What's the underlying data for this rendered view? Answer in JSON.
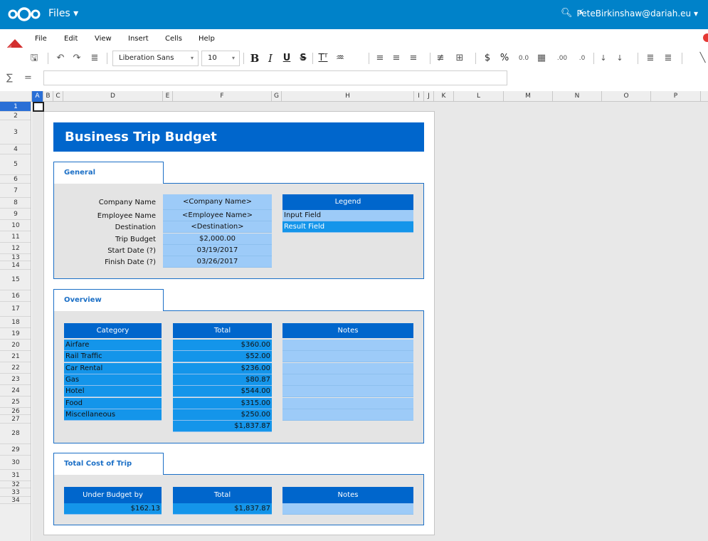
{
  "app": {
    "title": "Files ▾",
    "user": "PeteBirkinshaw@dariah.eu ▾",
    "brand_color": "#0082c9"
  },
  "menu": [
    "File",
    "Edit",
    "View",
    "Insert",
    "Cells",
    "Help"
  ],
  "toolbar": {
    "font_name": "Liberation Sans",
    "font_size": "10",
    "bold": "B",
    "italic": "I",
    "underline": "U",
    "strike": "S",
    "currency": "$",
    "percent": "%",
    "decimal": "0.0",
    "add_decimal": ".00",
    "remove_decimal": ".0"
  },
  "formula_bar": {
    "sum": "∑",
    "equals": "=",
    "value": ""
  },
  "columns": [
    "A",
    "B",
    "C",
    "D",
    "E",
    "F",
    "G",
    "H",
    "I",
    "J",
    "K",
    "L",
    "M",
    "N",
    "O",
    "P"
  ],
  "rows": [
    "1",
    "2",
    "3",
    "4",
    "5",
    "6",
    "7",
    "8",
    "9",
    "10",
    "11",
    "12",
    "13",
    "14",
    "15",
    "16",
    "17",
    "18",
    "19",
    "20",
    "21",
    "22",
    "23",
    "24",
    "25",
    "26",
    "27",
    "28",
    "29",
    "30",
    "31",
    "32",
    "33",
    "34"
  ],
  "sheet": {
    "title": "Business Trip Budget",
    "general": {
      "tab": "General",
      "fields": [
        {
          "label": "Company Name",
          "value": "<Company Name>"
        },
        {
          "label": "Employee Name",
          "value": "<Employee Name>"
        },
        {
          "label": "Destination",
          "value": "<Destination>"
        },
        {
          "label": "Trip Budget",
          "value": "$2,000.00"
        },
        {
          "label": "Start Date (?)",
          "value": "03/19/2017"
        },
        {
          "label": "Finish Date (?)",
          "value": "03/26/2017"
        }
      ],
      "legend": {
        "title": "Legend",
        "input": "Input Field",
        "result": "Result Field"
      }
    },
    "overview": {
      "tab": "Overview",
      "headers": {
        "category": "Category",
        "total": "Total",
        "notes": "Notes"
      },
      "rows": [
        {
          "category": "Airfare",
          "total": "$360.00"
        },
        {
          "category": "Rail Traffic",
          "total": "$52.00"
        },
        {
          "category": "Car Rental",
          "total": "$236.00"
        },
        {
          "category": "Gas",
          "total": "$80.87"
        },
        {
          "category": "Hotel",
          "total": "$544.00"
        },
        {
          "category": "Food",
          "total": "$315.00"
        },
        {
          "category": "Miscellaneous",
          "total": "$250.00"
        }
      ],
      "grand_total": "$1,837.87"
    },
    "total_cost": {
      "tab": "Total Cost of Trip",
      "headers": {
        "under": "Under Budget by",
        "total": "Total",
        "notes": "Notes"
      },
      "under_value": "$162.13",
      "total_value": "$1,837.87"
    }
  }
}
